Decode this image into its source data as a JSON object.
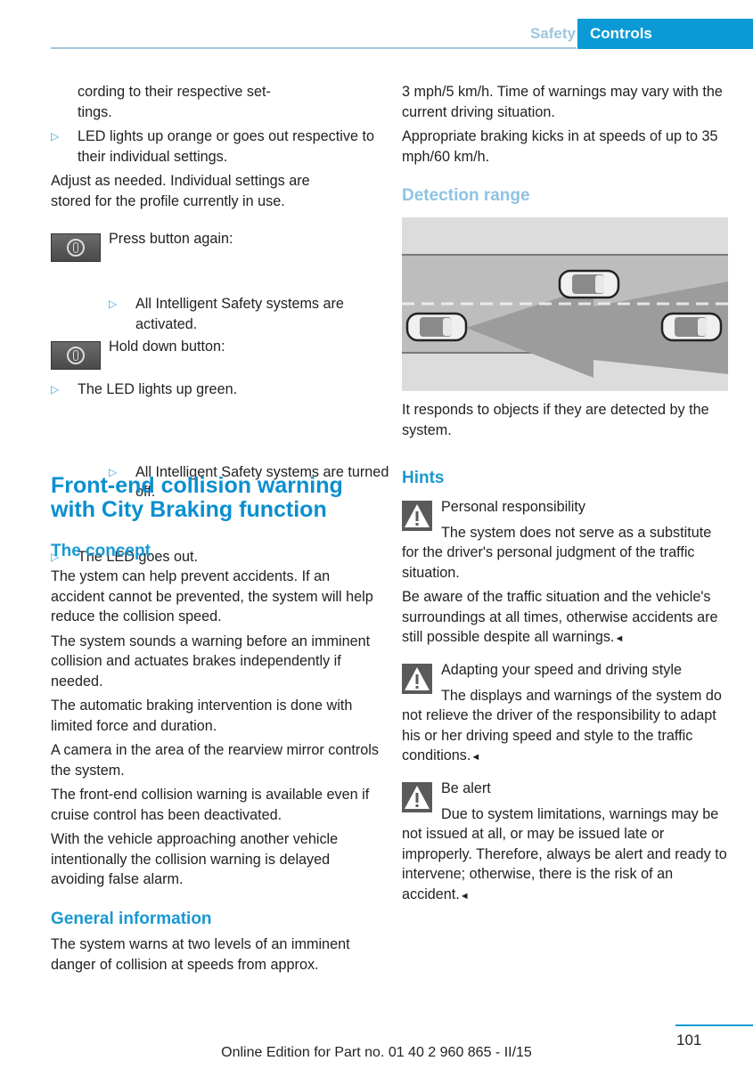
{
  "header": {
    "section": "Safety",
    "chapter": "Controls"
  },
  "left": {
    "intro_continuation": [
      "cording to their respective set-",
      "tings."
    ],
    "bullet_led_orange": "LED lights up orange or goes out respective to their individual settings.",
    "adjust_text": "Adjust as needed. Individual settings are stored for the profile currently in use.",
    "press_again": {
      "icon": "intelligent-safety-button-icon",
      "label": "Press button again:",
      "sub_bullet": "All Intelligent Safety systems are activated.",
      "result_bullet": "The LED lights up green."
    },
    "hold_down": {
      "icon": "intelligent-safety-button-icon",
      "label": "Hold down button:",
      "sub_bullet": "All Intelligent Safety systems are turned off.",
      "result_bullet": "The LED goes out."
    },
    "section_title": "Front-end collision warning with City Braking function",
    "concept": {
      "heading": "The concept",
      "paragraphs": [
        "The ystem can help prevent accidents. If an accident cannot be prevented, the system will help reduce the collision speed.",
        "The system sounds a warning before an imminent collision and actuates brakes independently if needed.",
        "The automatic braking intervention is done with limited force and duration.",
        "A camera in the area of the rearview mirror controls the system.",
        "The front-end collision warning is available even if cruise control has been deactivated.",
        "With the vehicle approaching another vehicle intentionally the collision warning is delayed avoiding false alarm."
      ]
    },
    "general": {
      "heading": "General information",
      "text": "The system warns at two levels of an imminent danger of collision at speeds from approx."
    }
  },
  "right": {
    "cont_para1": "3 mph/5 km/h. Time of warnings may vary with the current driving situation.",
    "cont_para2": "Appropriate braking kicks in at speeds of up to 35 mph/60 km/h.",
    "detection": {
      "heading": "Detection range",
      "figure_alt": "Top-down road diagram with three cars and a detection cone",
      "caption": "It responds to objects if they are detected by the system."
    },
    "hints": {
      "heading": "Hints",
      "warnings": [
        {
          "icon": "warning-triangle-icon",
          "title": "Personal responsibility",
          "paragraphs": [
            "The system does not serve as a substitute for the driver's personal judgment of the traffic situation.",
            "Be aware of the traffic situation and the vehicle's surroundings at all times, otherwise accidents are still possible despite all warnings."
          ]
        },
        {
          "icon": "warning-triangle-icon",
          "title": "Adapting your speed and driving style",
          "paragraphs": [
            "The displays and warnings of the system do not relieve the driver of the responsibility to adapt his or her driving speed and style to the traffic conditions."
          ]
        },
        {
          "icon": "warning-triangle-icon",
          "title": "Be alert",
          "paragraphs": [
            "Due to system limitations, warnings may be not issued at all, or may be issued late or improperly. Therefore, always be alert and ready to intervene; otherwise, there is the risk of an accident."
          ]
        }
      ],
      "end_marker": "◄"
    }
  },
  "footer": {
    "edition": "Online Edition for Part no. 01 40 2 960 865 - II/15",
    "page_number": "101"
  },
  "glyphs": {
    "bullet": "▷"
  },
  "colors": {
    "accent": "#0b9ad6",
    "heading_light": "#8ec3e3",
    "bullet": "#35a7d8"
  }
}
